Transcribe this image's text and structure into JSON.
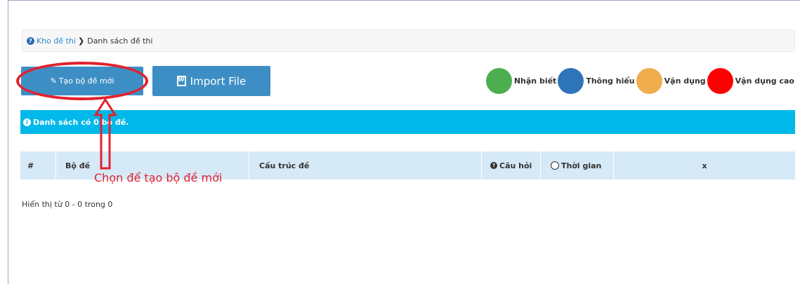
{
  "breadcrumb": {
    "root": "Kho đề thi",
    "current": "Danh sách đề thi"
  },
  "toolbar": {
    "new_label": "Tạo bộ đề mới",
    "import_label": "Import File"
  },
  "legend": [
    {
      "label": "Nhận biết",
      "color": "#4cae4f"
    },
    {
      "label": "Thông hiểu",
      "color": "#2e74b8"
    },
    {
      "label": "Vận dụng",
      "color": "#f0ad4e"
    },
    {
      "label": "Vận dụng cao",
      "color": "#ff0000"
    }
  ],
  "alert": {
    "text": "Danh sách có 0 bộ đề."
  },
  "table": {
    "headers": [
      "#",
      "Bộ đề",
      "Cấu trúc đề",
      "Câu hỏi",
      "Thời gian",
      "x"
    ],
    "rows": []
  },
  "pagination": {
    "summary": "Hiển thị từ 0 - 0 trong 0"
  },
  "annotation": {
    "text": "Chọn để tạo bộ đề mới",
    "color": "#e3212d"
  },
  "colors": {
    "primary_button": "#3d8ec4",
    "alert_bg": "#00b8ea",
    "table_header_bg": "#d6e9f7"
  }
}
